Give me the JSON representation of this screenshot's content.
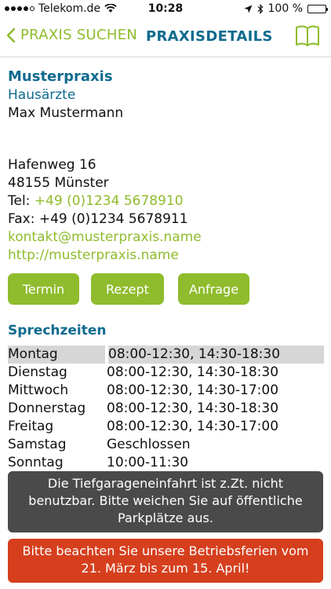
{
  "status_bar": {
    "carrier": "Telekom.de",
    "time": "10:28",
    "battery": "100 %"
  },
  "nav": {
    "back_label": "PRAXIS SUCHEN",
    "title": "PRAXISDETAILS",
    "book_icon": "book-icon"
  },
  "practice": {
    "name": "Musterpraxis",
    "type": "Hausärzte",
    "doctor": "Max Mustermann"
  },
  "contact": {
    "street": "Hafenweg 16",
    "city": "48155 Münster",
    "tel_label": "Tel: ",
    "tel_value": "+49 (0)1234 5678910",
    "fax": "Fax: +49 (0)1234 5678911",
    "email": "kontakt@musterpraxis.name",
    "website": "http://musterpraxis.name"
  },
  "buttons": {
    "termin": "Termin",
    "rezept": "Rezept",
    "anfrage": "Anfrage"
  },
  "hours": {
    "title": "Sprechzeiten",
    "rows": [
      {
        "day": "Montag",
        "time": "08:00-12:30, 14:30-18:30"
      },
      {
        "day": "Dienstag",
        "time": "08:00-12:30, 14:30-18:30"
      },
      {
        "day": "Mittwoch",
        "time": "08:00-12:30, 14:30-17:00"
      },
      {
        "day": "Donnerstag",
        "time": "08:00-12:30, 14:30-18:30"
      },
      {
        "day": "Freitag",
        "time": "08:00-12:30, 14:30-17:00"
      },
      {
        "day": "Samstag",
        "time": "Geschlossen"
      },
      {
        "day": "Sonntag",
        "time": "10:00-11:30"
      }
    ]
  },
  "notices": {
    "garage": "Die Tiefgarageneinfahrt ist z.Zt. nicht benutzbar. Bitte weichen Sie auf öffentliche Parkplätze aus.",
    "holiday": "Bitte beachten Sie unsere Betriebsferien vom 21. März bis zum 15. April!"
  },
  "colors": {
    "accent_green": "#8fbc2d",
    "brand_blue": "#0f6b8f",
    "notice_gray": "#4a4a4a",
    "notice_red": "#d63f1e",
    "today_highlight": "#d6d6d6"
  }
}
